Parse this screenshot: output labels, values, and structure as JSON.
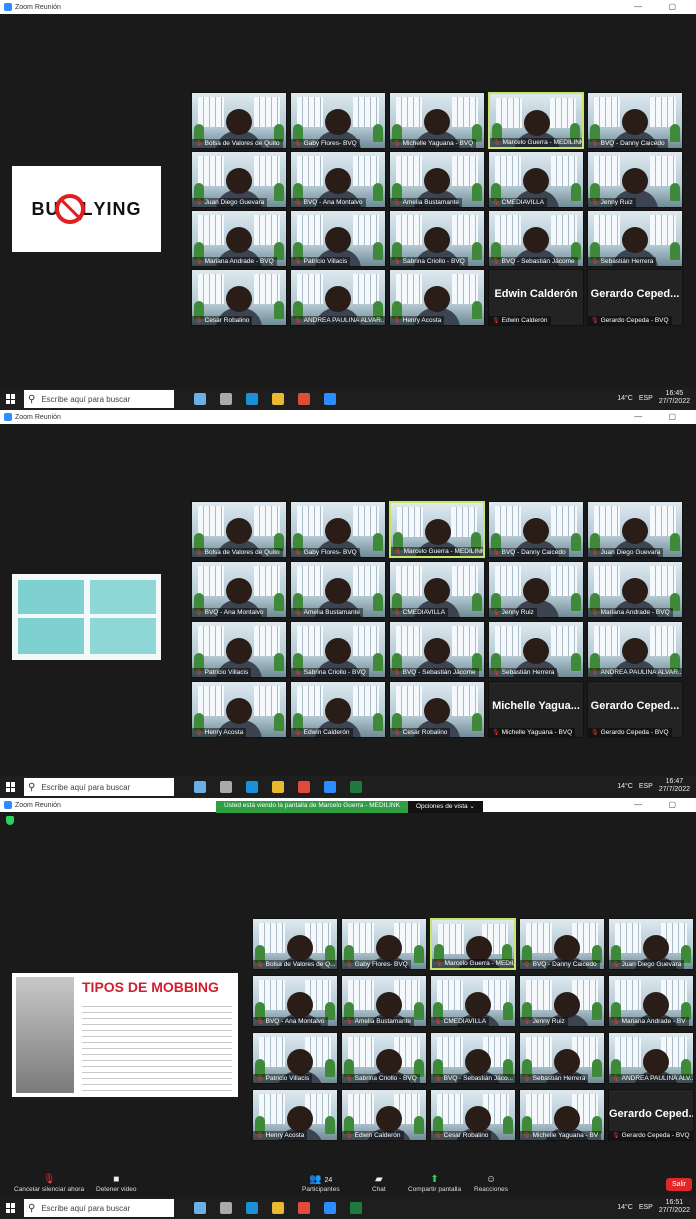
{
  "app_title": "Zoom Reunión",
  "taskbar": {
    "search_placeholder": "Escribe aquí para buscar",
    "temp": "14°C",
    "lang": "ESP"
  },
  "shot1": {
    "time": "16:45",
    "date": "27/7/2022",
    "slide_text": "BULLYING",
    "tiles": [
      {
        "label": "Bolsa de Valores de Quito"
      },
      {
        "label": "Gaby Flores- BVQ"
      },
      {
        "label": "Michelle Yaguana - BVQ"
      },
      {
        "label": "Marcelo Guerra - MEDILINK"
      },
      {
        "label": "BVQ - Danny Caicedo"
      },
      {
        "label": "Juan Diego Guevara"
      },
      {
        "label": "BVQ - Ana Montalvo"
      },
      {
        "label": "Amelia Bustamante"
      },
      {
        "label": "CMEDIAVILLA"
      },
      {
        "label": "Jenny Ruiz"
      },
      {
        "label": "Mariana Andrade - BVQ"
      },
      {
        "label": "Patricio Villacis"
      },
      {
        "label": "Sabrina Criollo - BVQ"
      },
      {
        "label": "BVQ - Sebastián Jácome"
      },
      {
        "label": "Sebastián Herrera"
      },
      {
        "label": "Cesar Robalino"
      },
      {
        "label": "ANDREA PAULINA ALVAR..."
      },
      {
        "label": "Henry Acosta"
      },
      {
        "label": "Edwin Calderón",
        "big": "Edwin Calderón"
      },
      {
        "label": "Gerardo Cepeda - BVQ",
        "big": "Gerardo Ceped..."
      }
    ]
  },
  "shot2": {
    "time": "16:47",
    "date": "27/7/2022",
    "tiles": [
      {
        "label": "Bolsa de Valores de Quito"
      },
      {
        "label": "Gaby Flores- BVQ"
      },
      {
        "label": "Marcelo Guerra - MEDILINK"
      },
      {
        "label": "BVQ - Danny Caicedo"
      },
      {
        "label": "Juan Diego Guevara"
      },
      {
        "label": "BVQ - Ana Montalvo"
      },
      {
        "label": "Amelia Bustamante"
      },
      {
        "label": "CMEDIAVILLA"
      },
      {
        "label": "Jenny Ruiz"
      },
      {
        "label": "Mariana Andrade - BVQ"
      },
      {
        "label": "Patricio Villacis"
      },
      {
        "label": "Sabrina Criollo - BVQ"
      },
      {
        "label": "BVQ - Sebastián Jácome"
      },
      {
        "label": "Sebastián Herrera"
      },
      {
        "label": "ANDREA PAULINA ALVAR..."
      },
      {
        "label": "Henry Acosta"
      },
      {
        "label": "Edwin Calderón"
      },
      {
        "label": "Cesar Robalino"
      },
      {
        "label": "Michelle Yaguana - BVQ",
        "big": "Michelle Yagua..."
      },
      {
        "label": "Gerardo Cepeda - BVQ",
        "big": "Gerardo Ceped..."
      }
    ]
  },
  "shot3": {
    "time": "16:51",
    "date": "27/7/2022",
    "banner": "Usted está viendo la pantalla de Marcelo Guerra - MEDILINK",
    "view_options": "Opciones de vista ⌄",
    "slide_title": "TIPOS DE MOBBING",
    "tiles": [
      {
        "label": "Bolsa de Valores de Q..."
      },
      {
        "label": "Gaby Flores- BVQ"
      },
      {
        "label": "Marcelo Guerra - MEDILI..."
      },
      {
        "label": "BVQ - Danny Caicedo"
      },
      {
        "label": "Juan Diego Guevara"
      },
      {
        "label": "BVQ - Ana Montalvo"
      },
      {
        "label": "Amelia Bustamante"
      },
      {
        "label": "CMEDIAVILLA"
      },
      {
        "label": "Jenny Ruiz"
      },
      {
        "label": "Mariana Andrade - BV"
      },
      {
        "label": "Patricio Villacis"
      },
      {
        "label": "Sabrina Criollo - BVQ"
      },
      {
        "label": "BVQ - Sebastián Jáco..."
      },
      {
        "label": "Sebastián Herrera"
      },
      {
        "label": "ANDREA PAULINA ALV..."
      },
      {
        "label": "Henry Acosta"
      },
      {
        "label": "Edwin Calderón"
      },
      {
        "label": "Cesar Robalino"
      },
      {
        "label": "Michelle Yaguana - BV"
      },
      {
        "label": "Gerardo Cepeda - BVQ",
        "big": "Gerardo Ceped..."
      }
    ],
    "controls": {
      "mute": "Cancelar silenciar ahora",
      "video": "Detener video",
      "participants": "Participantes",
      "participants_count": "24",
      "chat": "Chat",
      "share": "Compartir pantalla",
      "reactions": "Reacciones",
      "exit": "Salir"
    }
  }
}
